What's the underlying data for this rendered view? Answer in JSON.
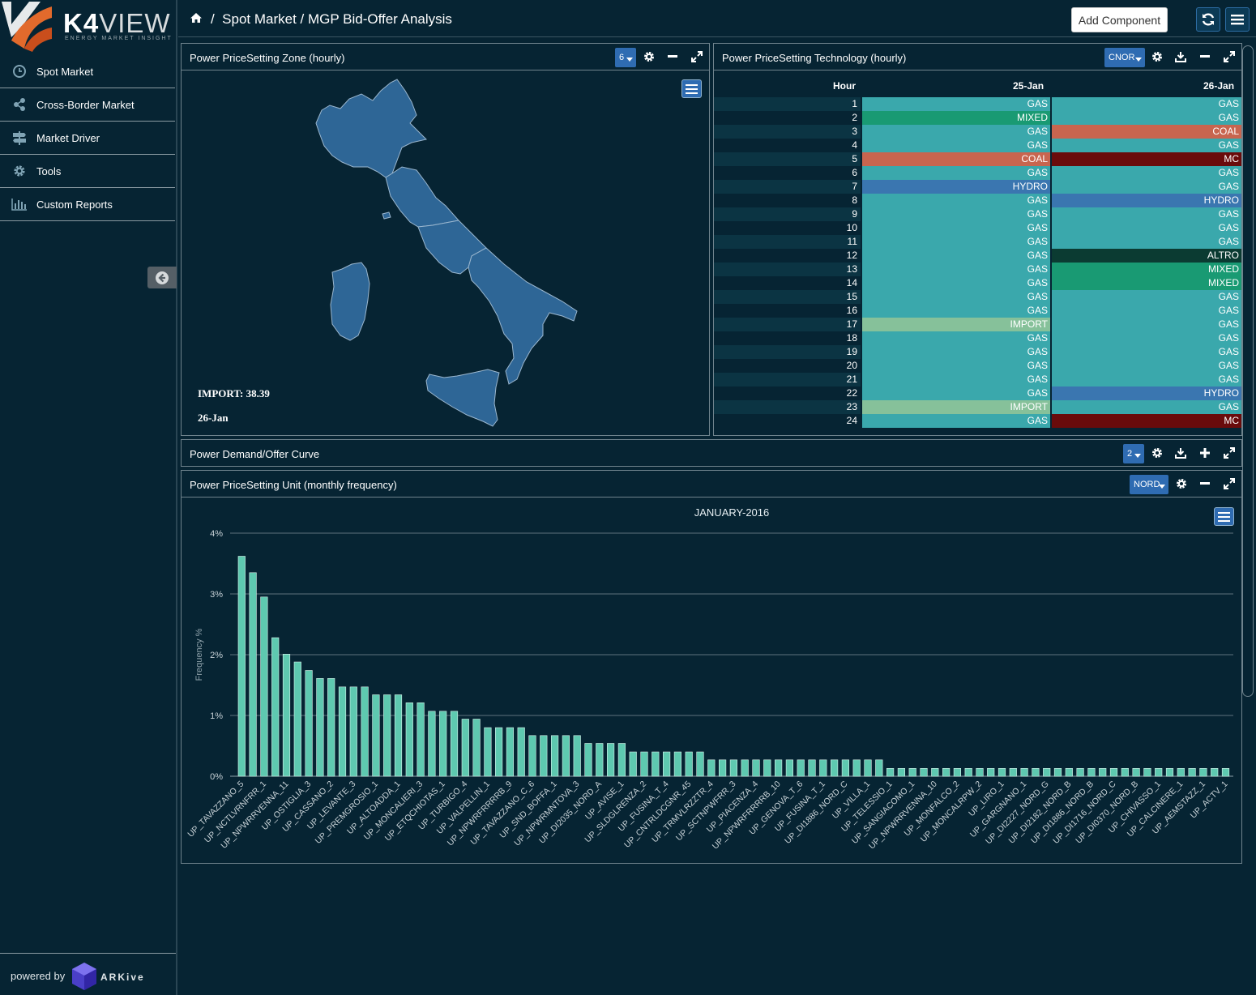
{
  "app": {
    "brand_prefix": "K4",
    "brand_suffix": "VIEW",
    "tagline": "ENERGY MARKET INSIGHT"
  },
  "sidebar": {
    "items": [
      {
        "label": "Spot Market",
        "icon": "clock-icon"
      },
      {
        "label": "Cross-Border Market",
        "icon": "share-icon"
      },
      {
        "label": "Market Driver",
        "icon": "signpost-icon"
      },
      {
        "label": "Tools",
        "icon": "gear-icon"
      },
      {
        "label": "Custom Reports",
        "icon": "bar-chart-icon"
      }
    ],
    "powered_by": "powered by",
    "powered_brand": "ARKive"
  },
  "header": {
    "breadcrumb": "Spot Market / MGP Bid-Offer Analysis",
    "add_component": "Add Component"
  },
  "panels": {
    "zone": {
      "title": "Power PriceSetting Zone (hourly)",
      "select_value": "6",
      "import_label": "IMPORT: 38.39",
      "date_label": "26-Jan"
    },
    "tech": {
      "title": "Power PriceSetting Technology (hourly)",
      "select_value": "CNOR",
      "headers": [
        "Hour",
        "25-Jan",
        "26-Jan"
      ],
      "rows": [
        [
          "1",
          "GAS",
          "GAS"
        ],
        [
          "2",
          "MIXED",
          "GAS"
        ],
        [
          "3",
          "GAS",
          "COAL"
        ],
        [
          "4",
          "GAS",
          "GAS"
        ],
        [
          "5",
          "COAL",
          "MC"
        ],
        [
          "6",
          "GAS",
          "GAS"
        ],
        [
          "7",
          "HYDRO",
          "GAS"
        ],
        [
          "8",
          "GAS",
          "HYDRO"
        ],
        [
          "9",
          "GAS",
          "GAS"
        ],
        [
          "10",
          "GAS",
          "GAS"
        ],
        [
          "11",
          "GAS",
          "GAS"
        ],
        [
          "12",
          "GAS",
          "ALTRO"
        ],
        [
          "13",
          "GAS",
          "MIXED"
        ],
        [
          "14",
          "GAS",
          "MIXED"
        ],
        [
          "15",
          "GAS",
          "GAS"
        ],
        [
          "16",
          "GAS",
          "GAS"
        ],
        [
          "17",
          "IMPORT",
          "GAS"
        ],
        [
          "18",
          "GAS",
          "GAS"
        ],
        [
          "19",
          "GAS",
          "GAS"
        ],
        [
          "20",
          "GAS",
          "GAS"
        ],
        [
          "21",
          "GAS",
          "GAS"
        ],
        [
          "22",
          "GAS",
          "HYDRO"
        ],
        [
          "23",
          "IMPORT",
          "GAS"
        ],
        [
          "24",
          "GAS",
          "MC"
        ]
      ],
      "colors": {
        "GAS": "#3aa8ac",
        "MIXED": "#199a73",
        "COAL": "#c8654f",
        "MC": "#6a0b0b",
        "HYDRO": "#3a76b0",
        "ALTRO": "#0b3b32",
        "IMPORT": "#86c19a"
      }
    },
    "demand": {
      "title": "Power Demand/Offer Curve",
      "select_value": "2"
    },
    "unit": {
      "title": "Power PriceSetting Unit (monthly frequency)",
      "select_value": "NORD"
    }
  },
  "chart_data": {
    "type": "bar",
    "title": "JANUARY-2016",
    "xlabel": "",
    "ylabel": "Frequency %",
    "ylim": [
      0,
      4
    ],
    "yticks": [
      "0%",
      "1%",
      "2%",
      "3%",
      "4%"
    ],
    "bar_color": "#5ec9b0",
    "categories": [
      "UP_TAVAZZANO_5",
      "UP_NCTLVRNFRR_1",
      "UP_NPWRRVENNA_11",
      "UP_OSTIGLIA_3",
      "UP_CASSANO_2",
      "UP_LEVANTE_3",
      "UP_PREMGROSIO_1",
      "UP_ALTOADDA_1",
      "UP_MONCALIERI_3",
      "UP_ETQCHIOTAS_1",
      "UP_TURBIGO_4",
      "UP_VALPELLIN_1",
      "UP_NPWRFRRRRB_9",
      "UP_TAVAZZANO_C_6",
      "UP_SND_BOFFA_1",
      "UP_NPWRMNTOVA_3",
      "UP_DI2035_NORD_A",
      "UP_AVISE_1",
      "UP_SLDGLRENZA_2",
      "UP_FUSINA_T_4",
      "UP_CNTRLDCGNR_45",
      "UP_TRMVLRZZTR_4",
      "UP_SCTNPWFRR_3",
      "UP_PIACENZA_4",
      "UP_NPWRFRRRRB_10",
      "UP_GENOVA_T_6",
      "UP_FUSINA_T_1",
      "UP_DI1886_NORD_C",
      "UP_VILLA_1",
      "UP_TELESSIO_1",
      "UP_SANGIACOMO_1",
      "UP_NPWRRVENNA_10",
      "UP_MONFALCO_2",
      "UP_MONCALRPW_2",
      "UP_LIRO_1",
      "UP_GARGNANO_1",
      "UP_DI2227_NORD_G",
      "UP_DI2182_NORD_B",
      "UP_DI1886_NORD_B",
      "UP_DI1716_NORD_C",
      "UP_DI0370_NORD_B",
      "UP_CHIVASSO_1",
      "UP_CALCINERE_1",
      "UP_AEMSTAZZ_1",
      "UP_ACTV_1"
    ],
    "all_values": [
      3.62,
      3.35,
      2.95,
      2.28,
      2.01,
      1.88,
      1.74,
      1.61,
      1.61,
      1.47,
      1.47,
      1.47,
      1.34,
      1.34,
      1.34,
      1.21,
      1.21,
      1.07,
      1.07,
      1.07,
      0.94,
      0.94,
      0.8,
      0.8,
      0.8,
      0.8,
      0.67,
      0.67,
      0.67,
      0.67,
      0.67,
      0.54,
      0.54,
      0.54,
      0.54,
      0.4,
      0.4,
      0.4,
      0.4,
      0.4,
      0.4,
      0.4,
      0.27,
      0.27,
      0.27,
      0.27,
      0.27,
      0.27,
      0.27,
      0.27,
      0.27,
      0.27,
      0.27,
      0.27,
      0.27,
      0.27,
      0.27,
      0.27,
      0.13,
      0.13,
      0.13,
      0.13,
      0.13,
      0.13,
      0.13,
      0.13,
      0.13,
      0.13,
      0.13,
      0.13,
      0.13,
      0.13,
      0.13,
      0.13,
      0.13,
      0.13,
      0.13,
      0.13,
      0.13,
      0.13,
      0.13,
      0.13,
      0.13,
      0.13,
      0.13,
      0.13,
      0.13,
      0.13,
      0.13
    ]
  }
}
